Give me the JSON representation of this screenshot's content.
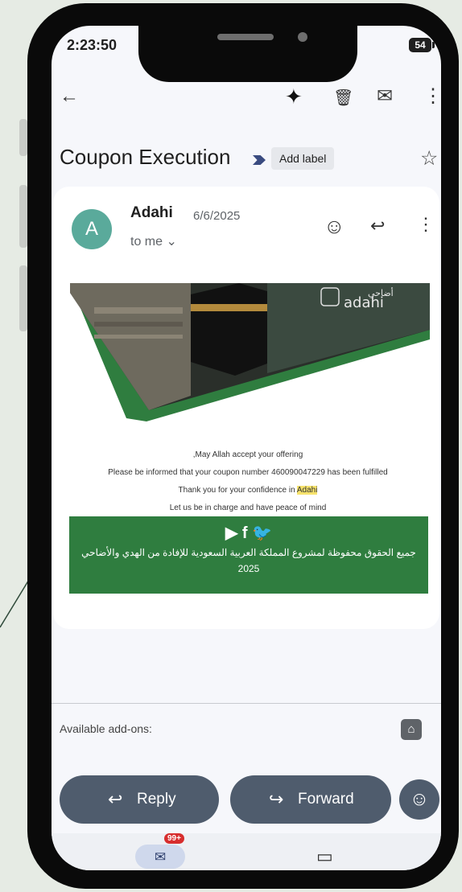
{
  "status": {
    "time": "2:23:50",
    "battery": "54"
  },
  "toolbar": {
    "back_icon": "←",
    "ai_icon": "✦",
    "delete_icon": "🗑",
    "mark_unread_icon": "✉",
    "more_icon": "⋮"
  },
  "subject": {
    "title": "Coupon Execution",
    "add_label": "Add label",
    "star_icon": "☆"
  },
  "message": {
    "avatar_letter": "A",
    "sender": "Adahi",
    "date": "6/6/2025",
    "to": "to me ⌄",
    "emoji_icon": "☺",
    "reply_icon": "↩",
    "more_icon": "⋮"
  },
  "email_body": {
    "brand_arabic": "أضاحي",
    "brand_latin": "adahi",
    "line1": ",May Allah accept your offering",
    "line2": "Please be informed that your coupon number 460090047229 has been fulfilled",
    "line3_prefix": "Thank you for your confidence in ",
    "line3_highlight": "Adahi",
    "line4": "Let us be in charge and have peace of mind",
    "footer_icons": "▶  f  🐦",
    "footer_arabic": "جميع الحقوق محفوظة لمشروع المملكة العربية السعودية للإفادة من الهدي والأضاحي",
    "footer_year": "2025"
  },
  "addons": {
    "label": "Available add-ons:",
    "icon": "⌂"
  },
  "actions": {
    "reply": "Reply",
    "reply_icon": "↩",
    "forward": "Forward",
    "forward_icon": "↪",
    "emoji_icon": "☺"
  },
  "nav": {
    "mail_icon": "✉",
    "badge": "99+",
    "video_icon": "▭"
  },
  "colors": {
    "accent": "#2f7d3f",
    "avatar": "#5aaa9b",
    "action_button": "#4f5c6d",
    "badge": "#d72d2d"
  }
}
